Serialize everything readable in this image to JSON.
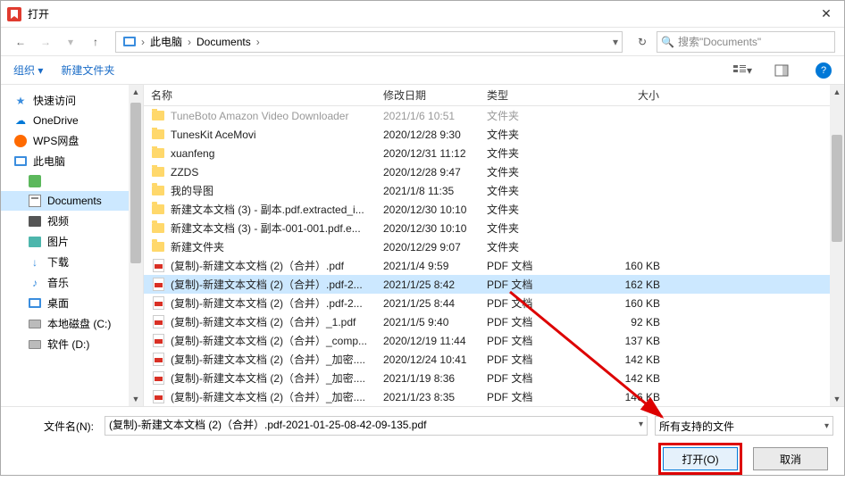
{
  "window": {
    "title": "打开"
  },
  "breadcrumb": {
    "pc": "此电脑",
    "folder": "Documents"
  },
  "search": {
    "placeholder": "搜索\"Documents\""
  },
  "toolbar": {
    "organize": "组织",
    "newfolder": "新建文件夹"
  },
  "columns": {
    "name": "名称",
    "date": "修改日期",
    "type": "类型",
    "size": "大小"
  },
  "sidebar": {
    "items": [
      {
        "label": "快速访问",
        "icon": "star",
        "indent": false
      },
      {
        "label": "OneDrive",
        "icon": "cloud",
        "indent": false
      },
      {
        "label": "WPS网盘",
        "icon": "wps",
        "indent": false
      },
      {
        "label": "此电脑",
        "icon": "monitor",
        "indent": false
      },
      {
        "label": "",
        "icon": "generic",
        "indent": true
      },
      {
        "label": "Documents",
        "icon": "docs",
        "indent": true,
        "selected": true
      },
      {
        "label": "视频",
        "icon": "video",
        "indent": true
      },
      {
        "label": "图片",
        "icon": "pic",
        "indent": true
      },
      {
        "label": "下载",
        "icon": "dl",
        "indent": true
      },
      {
        "label": "音乐",
        "icon": "music",
        "indent": true
      },
      {
        "label": "桌面",
        "icon": "desktop",
        "indent": true
      },
      {
        "label": "本地磁盘 (C:)",
        "icon": "disk",
        "indent": true
      },
      {
        "label": "软件 (D:)",
        "icon": "disk",
        "indent": true
      }
    ]
  },
  "files": [
    {
      "name": "TuneBoto Amazon Video Downloader",
      "date": "2021/1/6 10:51",
      "type": "文件夹",
      "size": "",
      "kind": "folder",
      "faded": true
    },
    {
      "name": "TunesKit AceMovi",
      "date": "2020/12/28 9:30",
      "type": "文件夹",
      "size": "",
      "kind": "folder"
    },
    {
      "name": "xuanfeng",
      "date": "2020/12/31 11:12",
      "type": "文件夹",
      "size": "",
      "kind": "folder"
    },
    {
      "name": "ZZDS",
      "date": "2020/12/28 9:47",
      "type": "文件夹",
      "size": "",
      "kind": "folder"
    },
    {
      "name": "我的导图",
      "date": "2021/1/8 11:35",
      "type": "文件夹",
      "size": "",
      "kind": "folder"
    },
    {
      "name": "新建文本文档 (3) - 副本.pdf.extracted_i...",
      "date": "2020/12/30 10:10",
      "type": "文件夹",
      "size": "",
      "kind": "folder"
    },
    {
      "name": "新建文本文档 (3) - 副本-001-001.pdf.e...",
      "date": "2020/12/30 10:10",
      "type": "文件夹",
      "size": "",
      "kind": "folder"
    },
    {
      "name": "新建文件夹",
      "date": "2020/12/29 9:07",
      "type": "文件夹",
      "size": "",
      "kind": "folder"
    },
    {
      "name": "(复制)-新建文本文档 (2)（合并）.pdf",
      "date": "2021/1/4 9:59",
      "type": "PDF 文档",
      "size": "160 KB",
      "kind": "pdf"
    },
    {
      "name": "(复制)-新建文本文档 (2)（合并）.pdf-2...",
      "date": "2021/1/25 8:42",
      "type": "PDF 文档",
      "size": "162 KB",
      "kind": "pdf",
      "selected": true
    },
    {
      "name": "(复制)-新建文本文档 (2)（合并）.pdf-2...",
      "date": "2021/1/25 8:44",
      "type": "PDF 文档",
      "size": "160 KB",
      "kind": "pdf"
    },
    {
      "name": "(复制)-新建文本文档 (2)（合并）_1.pdf",
      "date": "2021/1/5 9:40",
      "type": "PDF 文档",
      "size": "92 KB",
      "kind": "pdf"
    },
    {
      "name": "(复制)-新建文本文档 (2)（合并）_comp...",
      "date": "2020/12/19 11:44",
      "type": "PDF 文档",
      "size": "137 KB",
      "kind": "pdf"
    },
    {
      "name": "(复制)-新建文本文档 (2)（合并）_加密....",
      "date": "2020/12/24 10:41",
      "type": "PDF 文档",
      "size": "142 KB",
      "kind": "pdf"
    },
    {
      "name": "(复制)-新建文本文档 (2)（合并）_加密....",
      "date": "2021/1/19 8:36",
      "type": "PDF 文档",
      "size": "142 KB",
      "kind": "pdf"
    },
    {
      "name": "(复制)-新建文本文档 (2)（合并）_加密....",
      "date": "2021/1/23 8:35",
      "type": "PDF 文档",
      "size": "146 KB",
      "kind": "pdf"
    }
  ],
  "bottom": {
    "filename_label": "文件名(N):",
    "filename_value": "(复制)-新建文本文档 (2)（合并）.pdf-2021-01-25-08-42-09-135.pdf",
    "filter": "所有支持的文件",
    "open": "打开(O)",
    "cancel": "取消"
  }
}
